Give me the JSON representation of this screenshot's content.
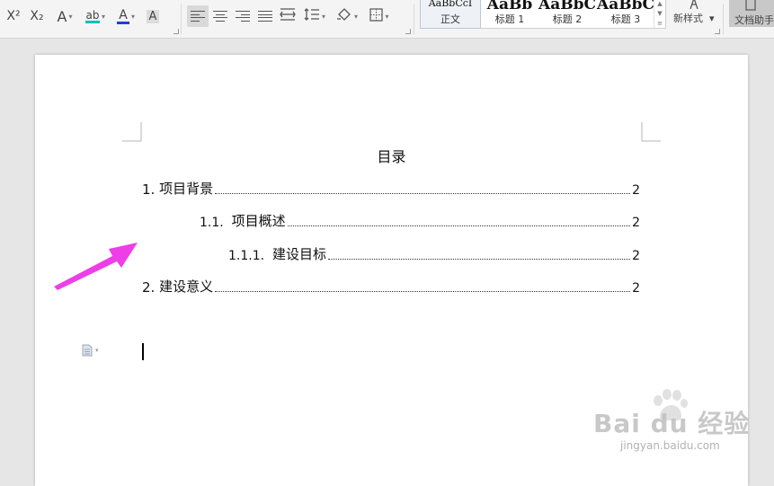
{
  "ribbon": {
    "superscript_label": "X²",
    "subscript_label": "X₂",
    "font_effect_label": "A",
    "highlight_label": "ab",
    "font_color_label": "A",
    "char_shading_label": "A",
    "styles": [
      {
        "preview": "AaBbCcI",
        "name": "正文"
      },
      {
        "preview": "AaBb",
        "name": "标题 1"
      },
      {
        "preview": "AaBbC",
        "name": "标题 2"
      },
      {
        "preview": "AaBbC",
        "name": "标题 3"
      }
    ],
    "new_style_label": "新样式",
    "doc_helper_label": "文档助手"
  },
  "colors": {
    "highlight": "#00c0c0",
    "font_color": "#1f3fd6",
    "arrow": "#ee3ee8"
  },
  "document": {
    "toc_title": "目录",
    "entries": [
      {
        "number": "1. ",
        "text": "项目背景",
        "page": "2"
      },
      {
        "number": "1.1.  ",
        "text": "项目概述",
        "page": "2"
      },
      {
        "number": "1.1.1.  ",
        "text": "建设目标",
        "page": "2"
      },
      {
        "number": "2. ",
        "text": "建设意义",
        "page": "2"
      }
    ]
  },
  "watermark": {
    "brand": "Bai du 经验",
    "url": "jingyan.baidu.com"
  }
}
